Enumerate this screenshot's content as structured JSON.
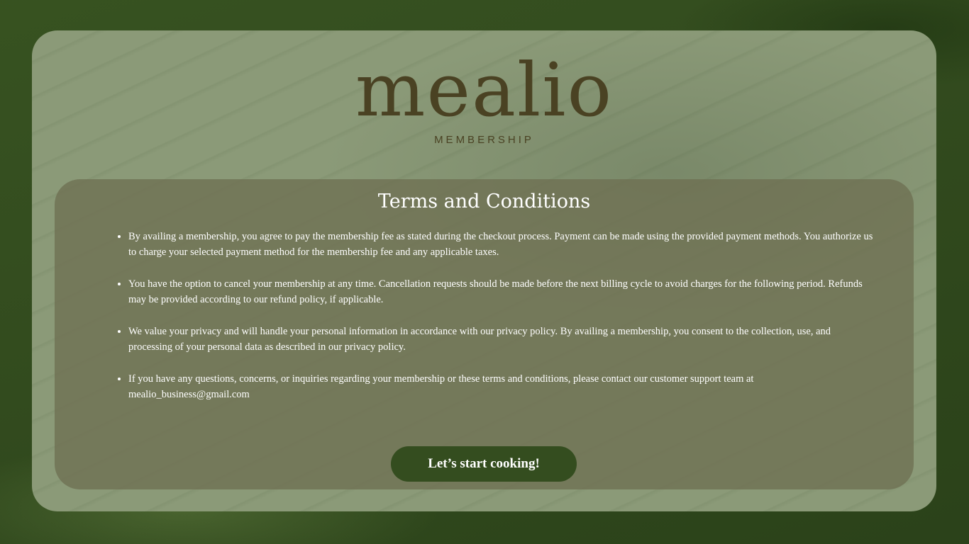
{
  "brand": {
    "logo_text": "mealio",
    "subtitle": "MEMBERSHIP"
  },
  "terms": {
    "title": "Terms and Conditions",
    "items": [
      "By availing a membership, you agree to pay the membership fee as stated during the checkout process. Payment can be made using the provided payment methods. You authorize us to charge your selected payment method for the membership fee and any applicable taxes.",
      "You have the option to cancel your membership at any time. Cancellation requests should be made before the next billing cycle to avoid charges for the following period. Refunds may be provided according to our refund policy, if applicable.",
      "We value your privacy and will handle your personal information in accordance with our privacy policy. By availing a membership, you consent to the collection, use, and processing of your personal data as described in our privacy policy.",
      "If you have any questions, concerns, or inquiries regarding your membership or these terms and conditions, please contact our customer support team at mealio_business@gmail.com"
    ]
  },
  "cta": {
    "label": "Let’s start cooking!"
  },
  "colors": {
    "background": "#344d1f",
    "card": "#8b9a78",
    "panel": "#6e7052",
    "logo": "#4a4223",
    "button": "#344d1f",
    "text_light": "#ffffff"
  }
}
